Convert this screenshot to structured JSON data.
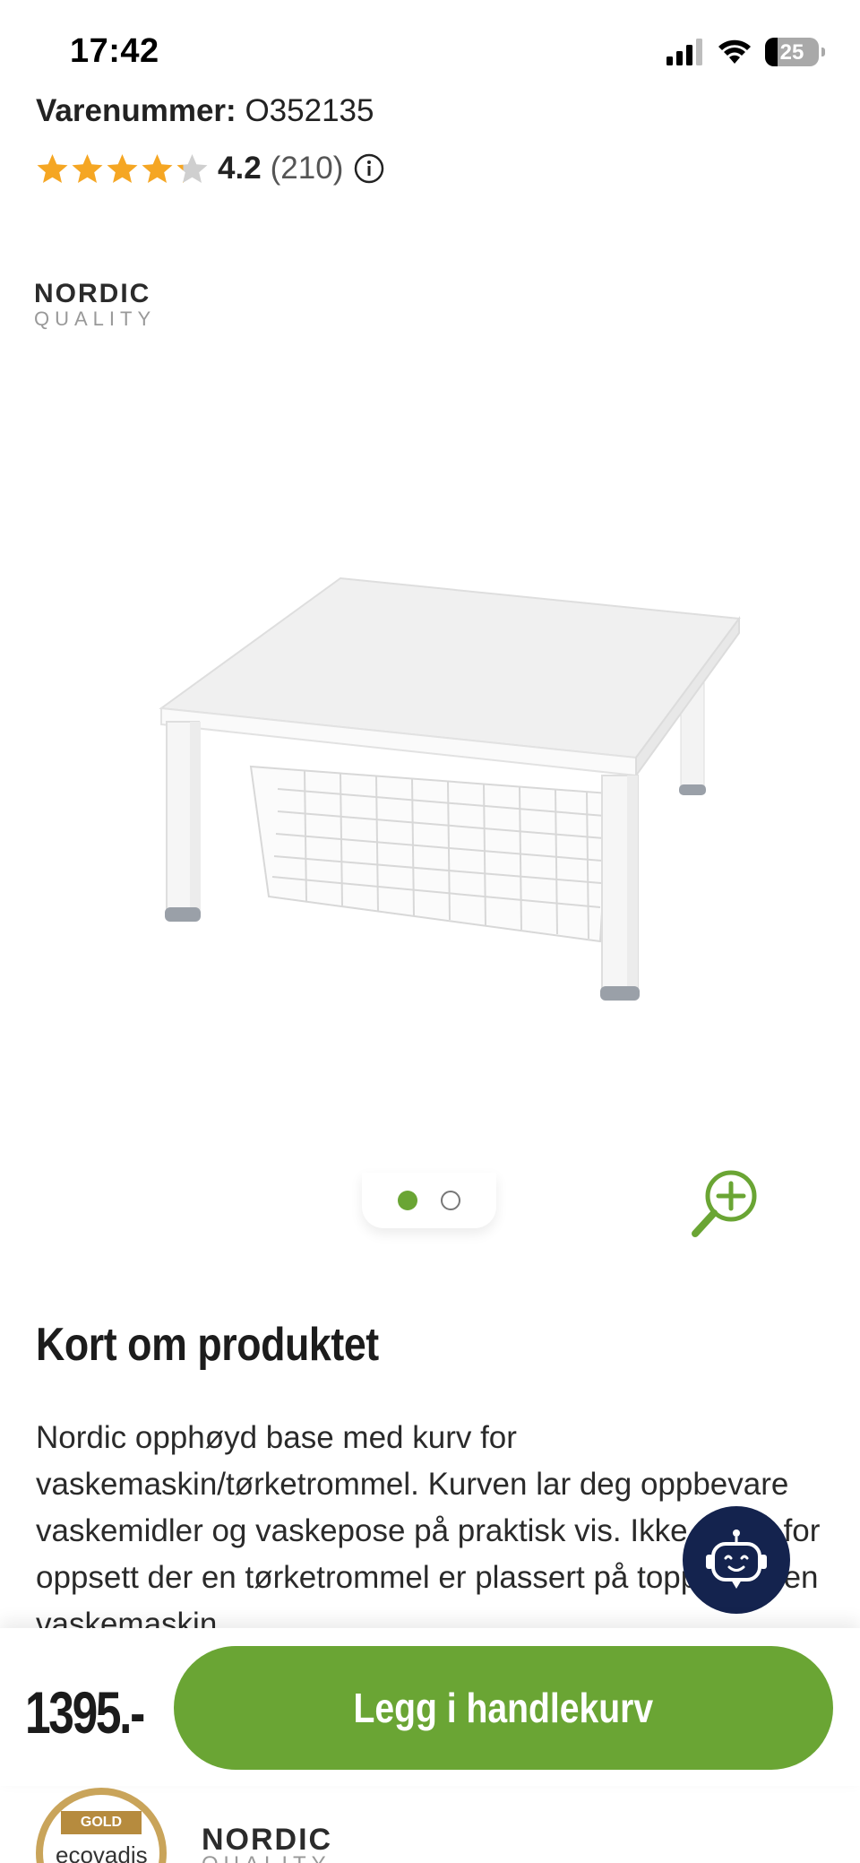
{
  "status_bar": {
    "time": "17:42",
    "battery": "25"
  },
  "product": {
    "sku_label": "Varenummer:",
    "sku_value": "O352135",
    "rating_value": "4.2",
    "rating_stars": 4.2,
    "rating_count": "(210)"
  },
  "brand": {
    "name": "NORDIC",
    "sub": "QUALITY"
  },
  "gallery": {
    "active_index": 0,
    "total": 2
  },
  "summary": {
    "title": "Kort om produktet",
    "text": "Nordic opphøyd base med kurv for vaskemaskin/tørketrommel. Kurven lar deg oppbevare vaskemidler og vaskepose på praktisk vis. Ikke egnet for oppsett der en tørketrommel er plassert på toppen av en vaskemaskin."
  },
  "purchase": {
    "price": "1395.-",
    "cart_label": "Legg i handlekurv"
  },
  "footer": {
    "ecovadis_ribbon": "GOLD",
    "ecovadis_name": "ecovadis",
    "brand_name": "NORDIC",
    "brand_sub": "QUALITY"
  },
  "colors": {
    "accent": "#6aa534",
    "star": "#f5a623",
    "chatbot": "#14234e"
  },
  "icons": [
    "signal-icon",
    "wifi-icon",
    "battery-icon",
    "star-icon",
    "info-icon",
    "zoom-in-icon",
    "chatbot-icon"
  ]
}
